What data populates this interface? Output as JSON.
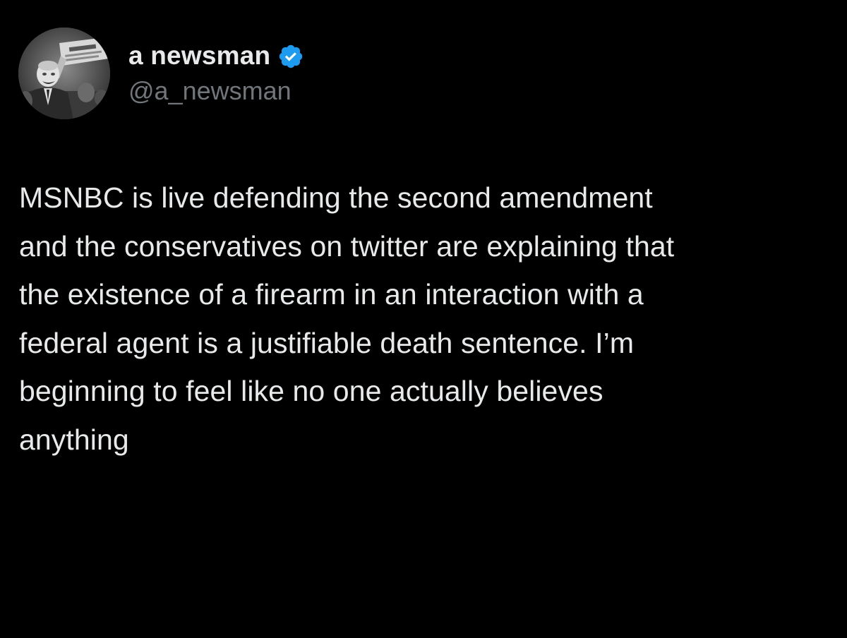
{
  "tweet": {
    "author": {
      "display_name": "a newsman",
      "handle": "@a_newsman",
      "verified_icon": "verified-badge-icon",
      "avatar": "profile-photo"
    },
    "text_lines": [
      "MSNBC is live defending the second amendment",
      "and the conservatives on twitter are explaining that",
      "the existence of a firearm in an interaction with a",
      "federal agent is a justifiable death sentence. I’m",
      "beginning to feel like no one actually believes",
      "anything"
    ]
  },
  "colors": {
    "background": "#000000",
    "primary_text": "#e7e9ea",
    "secondary_text": "#71767b",
    "verified_blue": "#1d9bf0"
  }
}
